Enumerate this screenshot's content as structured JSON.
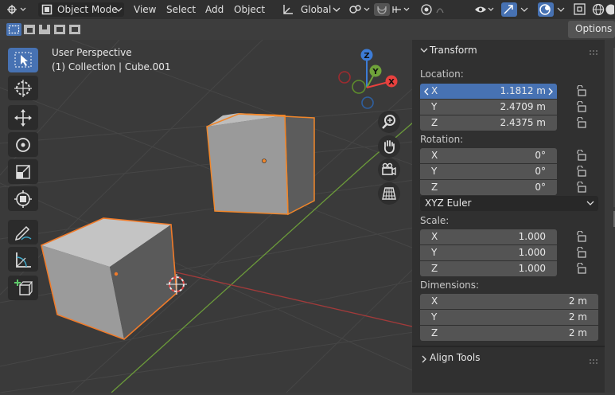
{
  "header": {
    "mode_label": "Object Mode",
    "menus": [
      "View",
      "Select",
      "Add",
      "Object"
    ],
    "orientation_label": "Global",
    "options_label": "Options"
  },
  "viewport": {
    "perspective_label": "User Perspective",
    "collection_label": "(1) Collection | Cube.001",
    "gizmo_axes": {
      "x": "X",
      "y": "Y",
      "z": "Z"
    }
  },
  "panel": {
    "transform_title": "Transform",
    "location_title": "Location:",
    "location": [
      {
        "axis": "X",
        "value": "1.1812 m"
      },
      {
        "axis": "Y",
        "value": "2.4709 m"
      },
      {
        "axis": "Z",
        "value": "2.4375 m"
      }
    ],
    "rotation_title": "Rotation:",
    "rotation": [
      {
        "axis": "X",
        "value": "0°"
      },
      {
        "axis": "Y",
        "value": "0°"
      },
      {
        "axis": "Z",
        "value": "0°"
      }
    ],
    "rotation_mode": "XYZ Euler",
    "scale_title": "Scale:",
    "scale": [
      {
        "axis": "X",
        "value": "1.000"
      },
      {
        "axis": "Y",
        "value": "1.000"
      },
      {
        "axis": "Z",
        "value": "1.000"
      }
    ],
    "dimensions_title": "Dimensions:",
    "dimensions": [
      {
        "axis": "X",
        "value": "2 m"
      },
      {
        "axis": "Y",
        "value": "2 m"
      },
      {
        "axis": "Z",
        "value": "2 m"
      }
    ],
    "align_tools_title": "Align Tools"
  },
  "colors": {
    "selection_orange": "#f0862a",
    "active_blue": "#4772b3",
    "x_axis_red": "#e8413e",
    "y_axis_green": "#6fa33a",
    "z_axis_blue": "#3d7cd6"
  }
}
